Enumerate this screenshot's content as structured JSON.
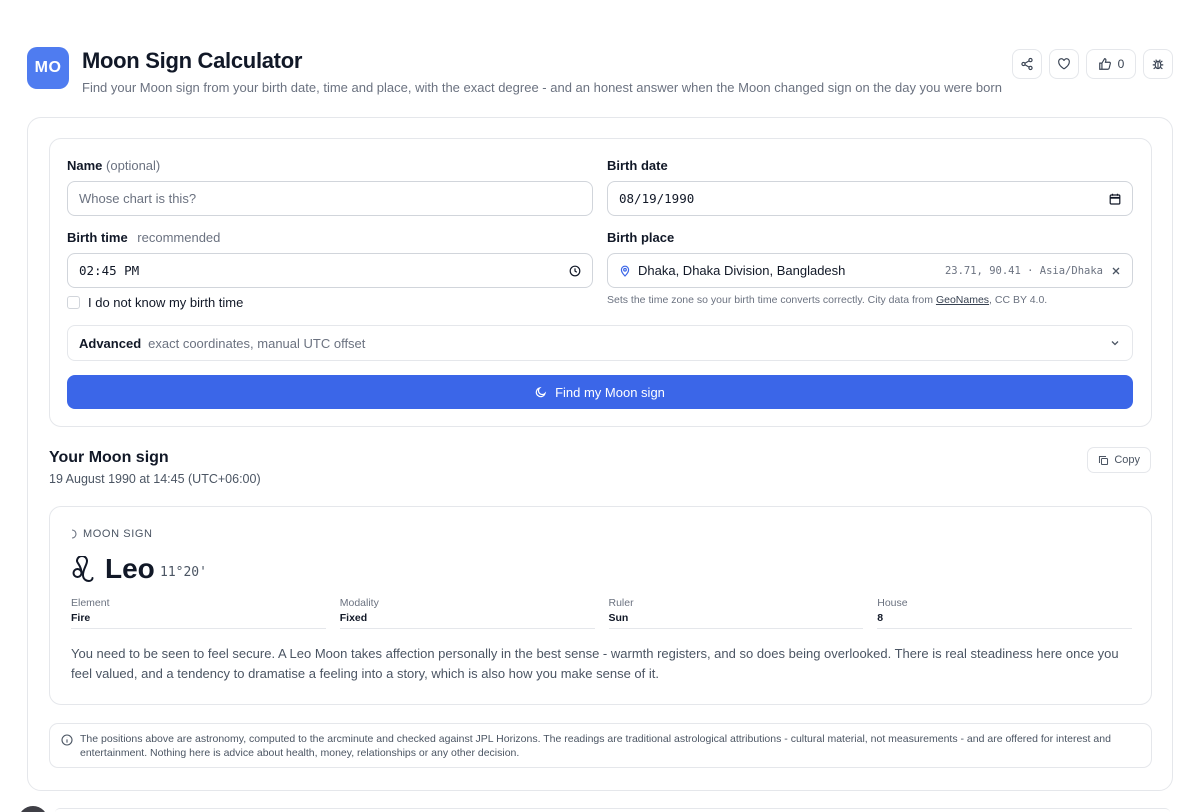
{
  "header": {
    "logo": "MO",
    "title": "Moon Sign Calculator",
    "subtitle": "Find your Moon sign from your birth date, time and place, with the exact degree - and an honest answer when the Moon changed sign on the day you were born",
    "like_count": "0",
    "icons": [
      "share-icon",
      "heart-icon",
      "thumbs-up-icon",
      "bug-icon"
    ]
  },
  "form": {
    "name_label": "Name",
    "name_optional": "(optional)",
    "name_placeholder": "Whose chart is this?",
    "date_label": "Birth date",
    "date_value": "08/19/1990",
    "time_label": "Birth time",
    "time_recommended": "recommended",
    "time_value": "02:45 PM",
    "unknown_time_label": "I do not know my birth time",
    "place_label": "Birth place",
    "place_value": "Dhaka, Dhaka Division, Bangladesh",
    "place_coords": "23.71, 90.41 · Asia/Dhaka",
    "place_hint_prefix": "Sets the time zone so your birth time converts correctly. City data from ",
    "place_hint_link": "GeoNames",
    "place_hint_suffix": ", CC BY 4.0.",
    "advanced_label": "Advanced",
    "advanced_desc": "exact coordinates, manual UTC offset",
    "submit_label": "Find my Moon sign"
  },
  "result": {
    "title": "Your Moon sign",
    "datetime": "19 August 1990 at 14:45 (UTC+06:00)",
    "copy_label": "Copy",
    "eyebrow": "MOON SIGN",
    "sign": "Leo",
    "degree": "11°20'",
    "attributes": [
      {
        "key": "Element",
        "value": "Fire"
      },
      {
        "key": "Modality",
        "value": "Fixed"
      },
      {
        "key": "Ruler",
        "value": "Sun"
      },
      {
        "key": "House",
        "value": "8"
      }
    ],
    "description": "You need to be seen to feel secure. A Leo Moon takes affection personally in the best sense - warmth registers, and so does being overlooked. There is real steadiness here once you feel valued, and a tendency to dramatise a feeling into a story, which is also how you make sense of it."
  },
  "disclaimer": "The positions above are astronomy, computed to the arcminute and checked against JPL Horizons. The readings are traditional astrological attributions - cultural material, not measurements - and are offered for interest and entertainment. Nothing here is advice about health, money, relationships or any other decision.",
  "colors": {
    "accent": "#3b66e8",
    "logo": "#4f7cf0",
    "border": "#e5e7eb",
    "muted": "#6b7280"
  }
}
